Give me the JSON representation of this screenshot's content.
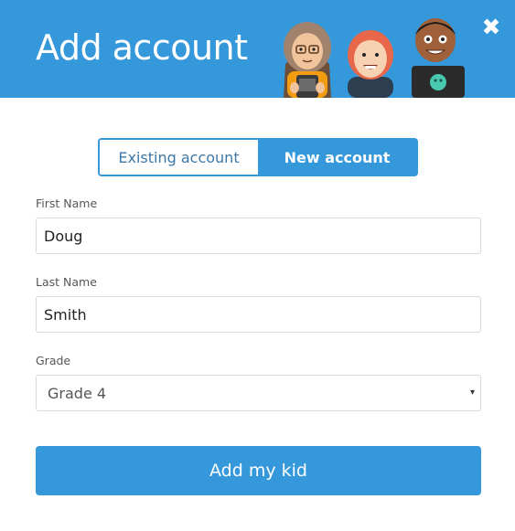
{
  "header": {
    "title": "Add account",
    "close_icon": "✖",
    "illustration": "three-kids-illustration",
    "background_color": "#3498db"
  },
  "tabs": [
    {
      "label": "Existing account",
      "selected": false
    },
    {
      "label": "New account",
      "selected": true
    }
  ],
  "form": {
    "first_name": {
      "label": "First Name",
      "value": "Doug"
    },
    "last_name": {
      "label": "Last Name",
      "value": "Smith"
    },
    "grade": {
      "label": "Grade",
      "value": "Grade 4",
      "caret": "▾"
    }
  },
  "submit_label": "Add my kid",
  "accent_color": "#3498db"
}
